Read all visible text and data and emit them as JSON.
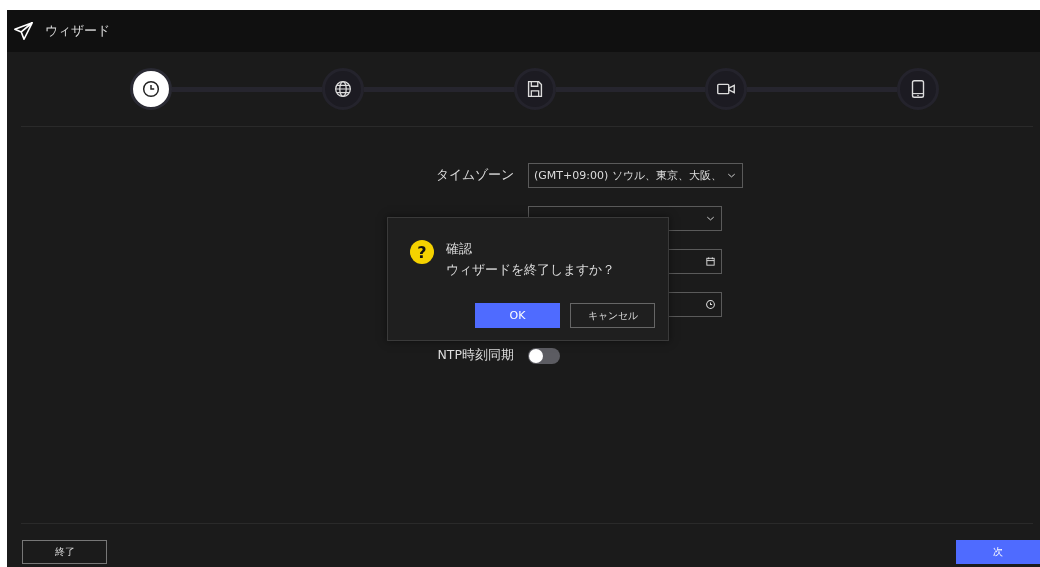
{
  "window": {
    "title": "ウィザード"
  },
  "steps": [
    {
      "kind": "clock",
      "selected": true
    },
    {
      "kind": "globe",
      "selected": false
    },
    {
      "kind": "disk",
      "selected": false
    },
    {
      "kind": "camera",
      "selected": false
    },
    {
      "kind": "tablet",
      "selected": false
    }
  ],
  "form": {
    "timezone": {
      "label": "タイムゾーン",
      "value": "(GMT+09:00) ソウル、東京、大阪、"
    },
    "fields": [
      {
        "kind": "select"
      },
      {
        "kind": "date"
      },
      {
        "kind": "time"
      }
    ],
    "ntp": {
      "label": "NTP時刻同期",
      "on": false
    }
  },
  "dialog": {
    "icon": "?",
    "title": "確認",
    "message": "ウィザードを終了しますか？",
    "buttons": [
      {
        "label": "OK",
        "kind": "primary"
      },
      {
        "label": "キャンセル",
        "kind": "secondary"
      }
    ]
  },
  "footer": {
    "left_button": "終了",
    "right_button": "次"
  }
}
